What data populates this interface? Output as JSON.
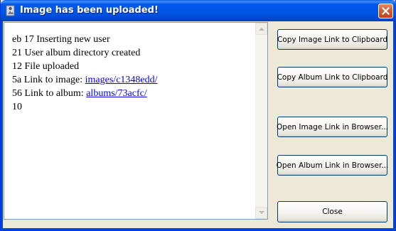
{
  "window": {
    "title": "Image has been uploaded!"
  },
  "log": {
    "lines": [
      {
        "prefix": "eb 17 Inserting new user"
      },
      {
        "prefix": "21 User album directory created"
      },
      {
        "prefix": "12 File uploaded"
      },
      {
        "prefix": "5a Link to image: ",
        "link": "images/c1348edd/"
      },
      {
        "prefix": "56 Link to album: ",
        "link": "albums/73acfc/"
      },
      {
        "prefix": "10"
      }
    ]
  },
  "buttons": {
    "copy_image": "Copy Image Link to Clipboard",
    "copy_album": "Copy Album Link to Clipboard",
    "open_image": "Open Image Link in Browser...",
    "open_album": "Open Album Link in Browser...",
    "close": "Close"
  },
  "icons": {
    "app": "app-icon",
    "close": "close-icon",
    "scroll_up": "scroll-up-arrow-icon",
    "scroll_down": "scroll-down-arrow-icon"
  },
  "colors": {
    "titlebar": "#0055e5",
    "window_bg": "#ece9d8",
    "link": "#0000ee",
    "close_button": "#d65c32"
  }
}
